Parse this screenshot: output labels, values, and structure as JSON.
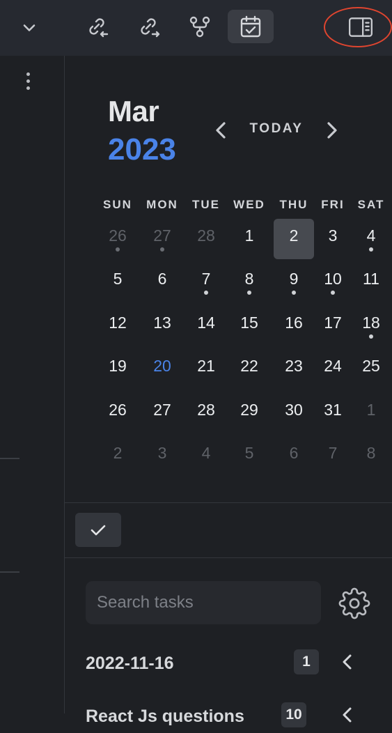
{
  "toolbar": {
    "buttons": [
      {
        "name": "backlinks-icon"
      },
      {
        "name": "outgoing-links-icon"
      },
      {
        "name": "graph-icon"
      },
      {
        "name": "calendar-icon"
      }
    ],
    "active_button": "calendar-icon",
    "right_button": "sidebar-toggle-icon",
    "highlight_color": "#e0452f"
  },
  "calendar": {
    "month": "Mar",
    "year": "2023",
    "today_label": "TODAY",
    "weekdays": [
      "SUN",
      "MON",
      "TUE",
      "WED",
      "THU",
      "FRI",
      "SAT"
    ],
    "weeks": [
      [
        {
          "d": "26",
          "adj": true,
          "dot": true
        },
        {
          "d": "27",
          "adj": true,
          "dot": true
        },
        {
          "d": "28",
          "adj": true
        },
        {
          "d": "1"
        },
        {
          "d": "2",
          "selected": true
        },
        {
          "d": "3"
        },
        {
          "d": "4",
          "dot": true
        }
      ],
      [
        {
          "d": "5"
        },
        {
          "d": "6"
        },
        {
          "d": "7",
          "dot": true
        },
        {
          "d": "8",
          "dot": true
        },
        {
          "d": "9",
          "dot": true
        },
        {
          "d": "10",
          "dot": true
        },
        {
          "d": "11"
        }
      ],
      [
        {
          "d": "12"
        },
        {
          "d": "13"
        },
        {
          "d": "14"
        },
        {
          "d": "15"
        },
        {
          "d": "16"
        },
        {
          "d": "17"
        },
        {
          "d": "18",
          "dot": true
        }
      ],
      [
        {
          "d": "19"
        },
        {
          "d": "20",
          "today": true
        },
        {
          "d": "21"
        },
        {
          "d": "22"
        },
        {
          "d": "23"
        },
        {
          "d": "24"
        },
        {
          "d": "25"
        }
      ],
      [
        {
          "d": "26"
        },
        {
          "d": "27"
        },
        {
          "d": "28"
        },
        {
          "d": "29"
        },
        {
          "d": "30"
        },
        {
          "d": "31"
        },
        {
          "d": "1",
          "adj": true
        }
      ],
      [
        {
          "d": "2",
          "adj": true
        },
        {
          "d": "3",
          "adj": true
        },
        {
          "d": "4",
          "adj": true
        },
        {
          "d": "5",
          "adj": true
        },
        {
          "d": "6",
          "adj": true
        },
        {
          "d": "7",
          "adj": true
        },
        {
          "d": "8",
          "adj": true
        }
      ]
    ],
    "accent_color": "#4a83e8"
  },
  "tasks": {
    "search_placeholder": "Search tasks",
    "groups": [
      {
        "label": "2022-11-16",
        "count": "1"
      },
      {
        "label": "React Js questions",
        "count": "10"
      }
    ]
  }
}
